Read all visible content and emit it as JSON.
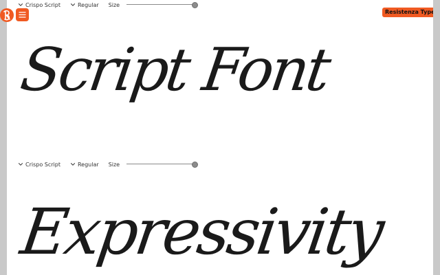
{
  "toolbar_top": {
    "family": "Crispo Script",
    "style": "Regular",
    "size_label": "Size",
    "size_level_percent": 100
  },
  "toolbar_bottom": {
    "family": "Crispo Script",
    "style": "Regular",
    "size_label": "Size",
    "size_level_percent": 100
  },
  "brand": {
    "label": "Resistenza Type"
  },
  "samples": [
    "Script Font",
    "Expressivity"
  ],
  "colors": {
    "accent": "#f05a22",
    "text": "#1a1a1a",
    "background": "#ffffff",
    "gutter": "#c9c9c9"
  },
  "icons": {
    "logo": "resistenza-logo-icon",
    "menu": "hamburger-menu-icon",
    "dropdown": "chevron-down-icon",
    "slider": "slider-thumb"
  }
}
